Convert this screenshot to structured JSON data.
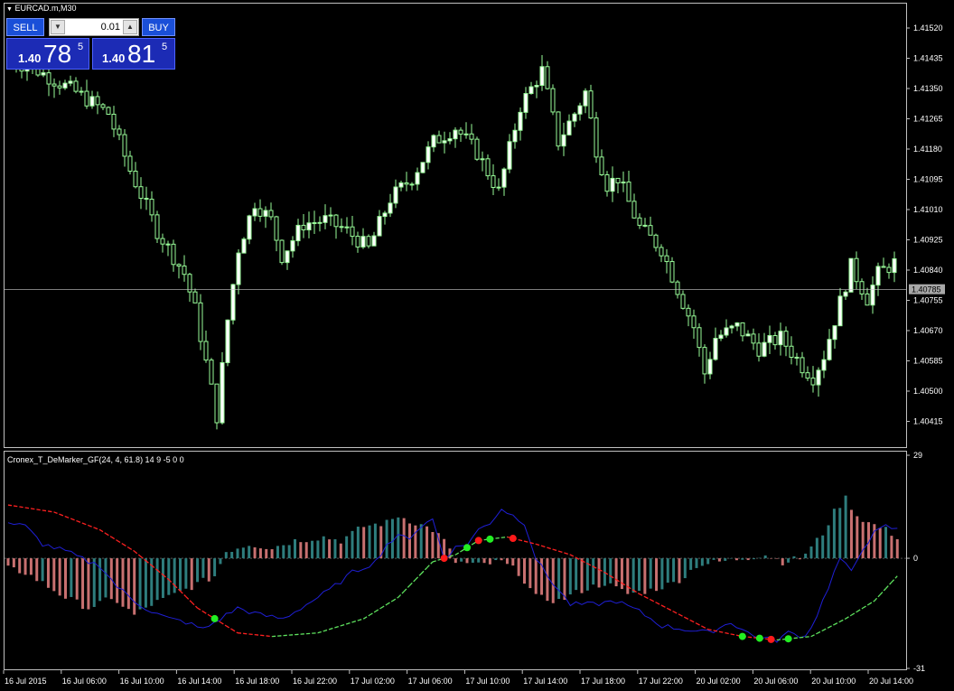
{
  "window": {
    "symbol_title": "EURCAD.m,M30"
  },
  "trade_panel": {
    "sell_label": "SELL",
    "buy_label": "BUY",
    "lot_value": "0.01",
    "sell_price": {
      "prefix": "1.40",
      "big": "78",
      "sup": "5"
    },
    "buy_price": {
      "prefix": "1.40",
      "big": "81",
      "sup": "5"
    }
  },
  "price_axis": {
    "labels": [
      "1.41520",
      "1.41435",
      "1.41350",
      "1.41265",
      "1.41180",
      "1.41095",
      "1.41010",
      "1.40925",
      "1.40840",
      "1.40755",
      "1.40670",
      "1.40585",
      "1.40500",
      "1.40415"
    ],
    "current_price": "1.40785",
    "current_value": 1.40785
  },
  "time_axis": {
    "labels": [
      "16 Jul 2015",
      "16 Jul 06:00",
      "16 Jul 10:00",
      "16 Jul 14:00",
      "16 Jul 18:00",
      "16 Jul 22:00",
      "17 Jul 02:00",
      "17 Jul 06:00",
      "17 Jul 10:00",
      "17 Jul 14:00",
      "17 Jul 18:00",
      "17 Jul 22:00",
      "20 Jul 02:00",
      "20 Jul 06:00",
      "20 Jul 10:00",
      "20 Jul 14:00"
    ]
  },
  "indicator": {
    "title": "Cronex_T_DeMarker_GF(24, 4, 61.8) 14 9 -5 0 0",
    "axis_labels": [
      "29",
      "0",
      "-31"
    ],
    "ymax": 29,
    "ymin": -31
  },
  "colors": {
    "background": "#000000",
    "frame": "#c0c0c0",
    "candle": "#98fb98",
    "candle_body": "#ffffff",
    "hist_teal": "#2e7d7d",
    "hist_pink": "#c87070",
    "line_blue": "#1f1fd6",
    "curve_red": "#ff2020",
    "curve_green": "#5ee35e"
  }
}
